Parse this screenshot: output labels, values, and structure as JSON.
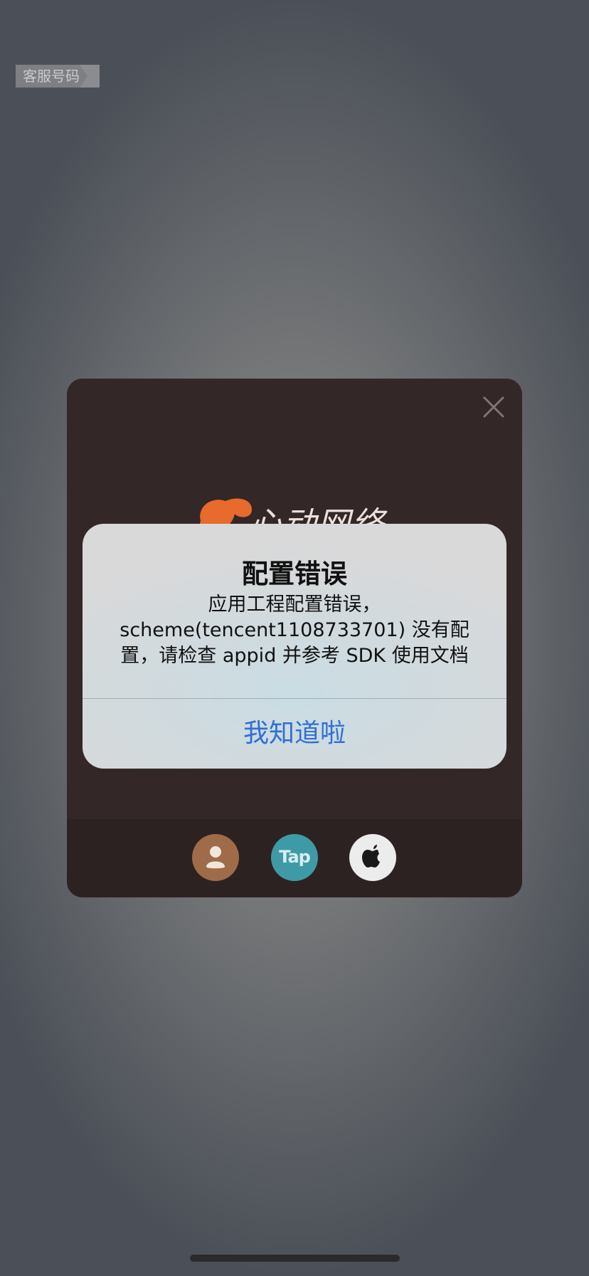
{
  "corner_tag": {
    "label": "客服号码"
  },
  "login_panel": {
    "logo_text": "心动网络",
    "login_options": [
      {
        "icon": "user-icon",
        "label": ""
      },
      {
        "icon": "taptap-icon",
        "label": "Tap"
      },
      {
        "icon": "apple-icon",
        "label": ""
      }
    ]
  },
  "alert": {
    "title": "配置错误",
    "message": "应用工程配置错误，scheme(tencent1108733701) 没有配置，请检查 appid 并参考 SDK 使用文档",
    "button": "我知道啦"
  },
  "colors": {
    "panel_bg": "#332727",
    "accent_orange": "#e86a2c",
    "button_blue": "#2f6fd6",
    "tap_teal": "#3f9aa7",
    "user_brown": "#a06b48"
  }
}
